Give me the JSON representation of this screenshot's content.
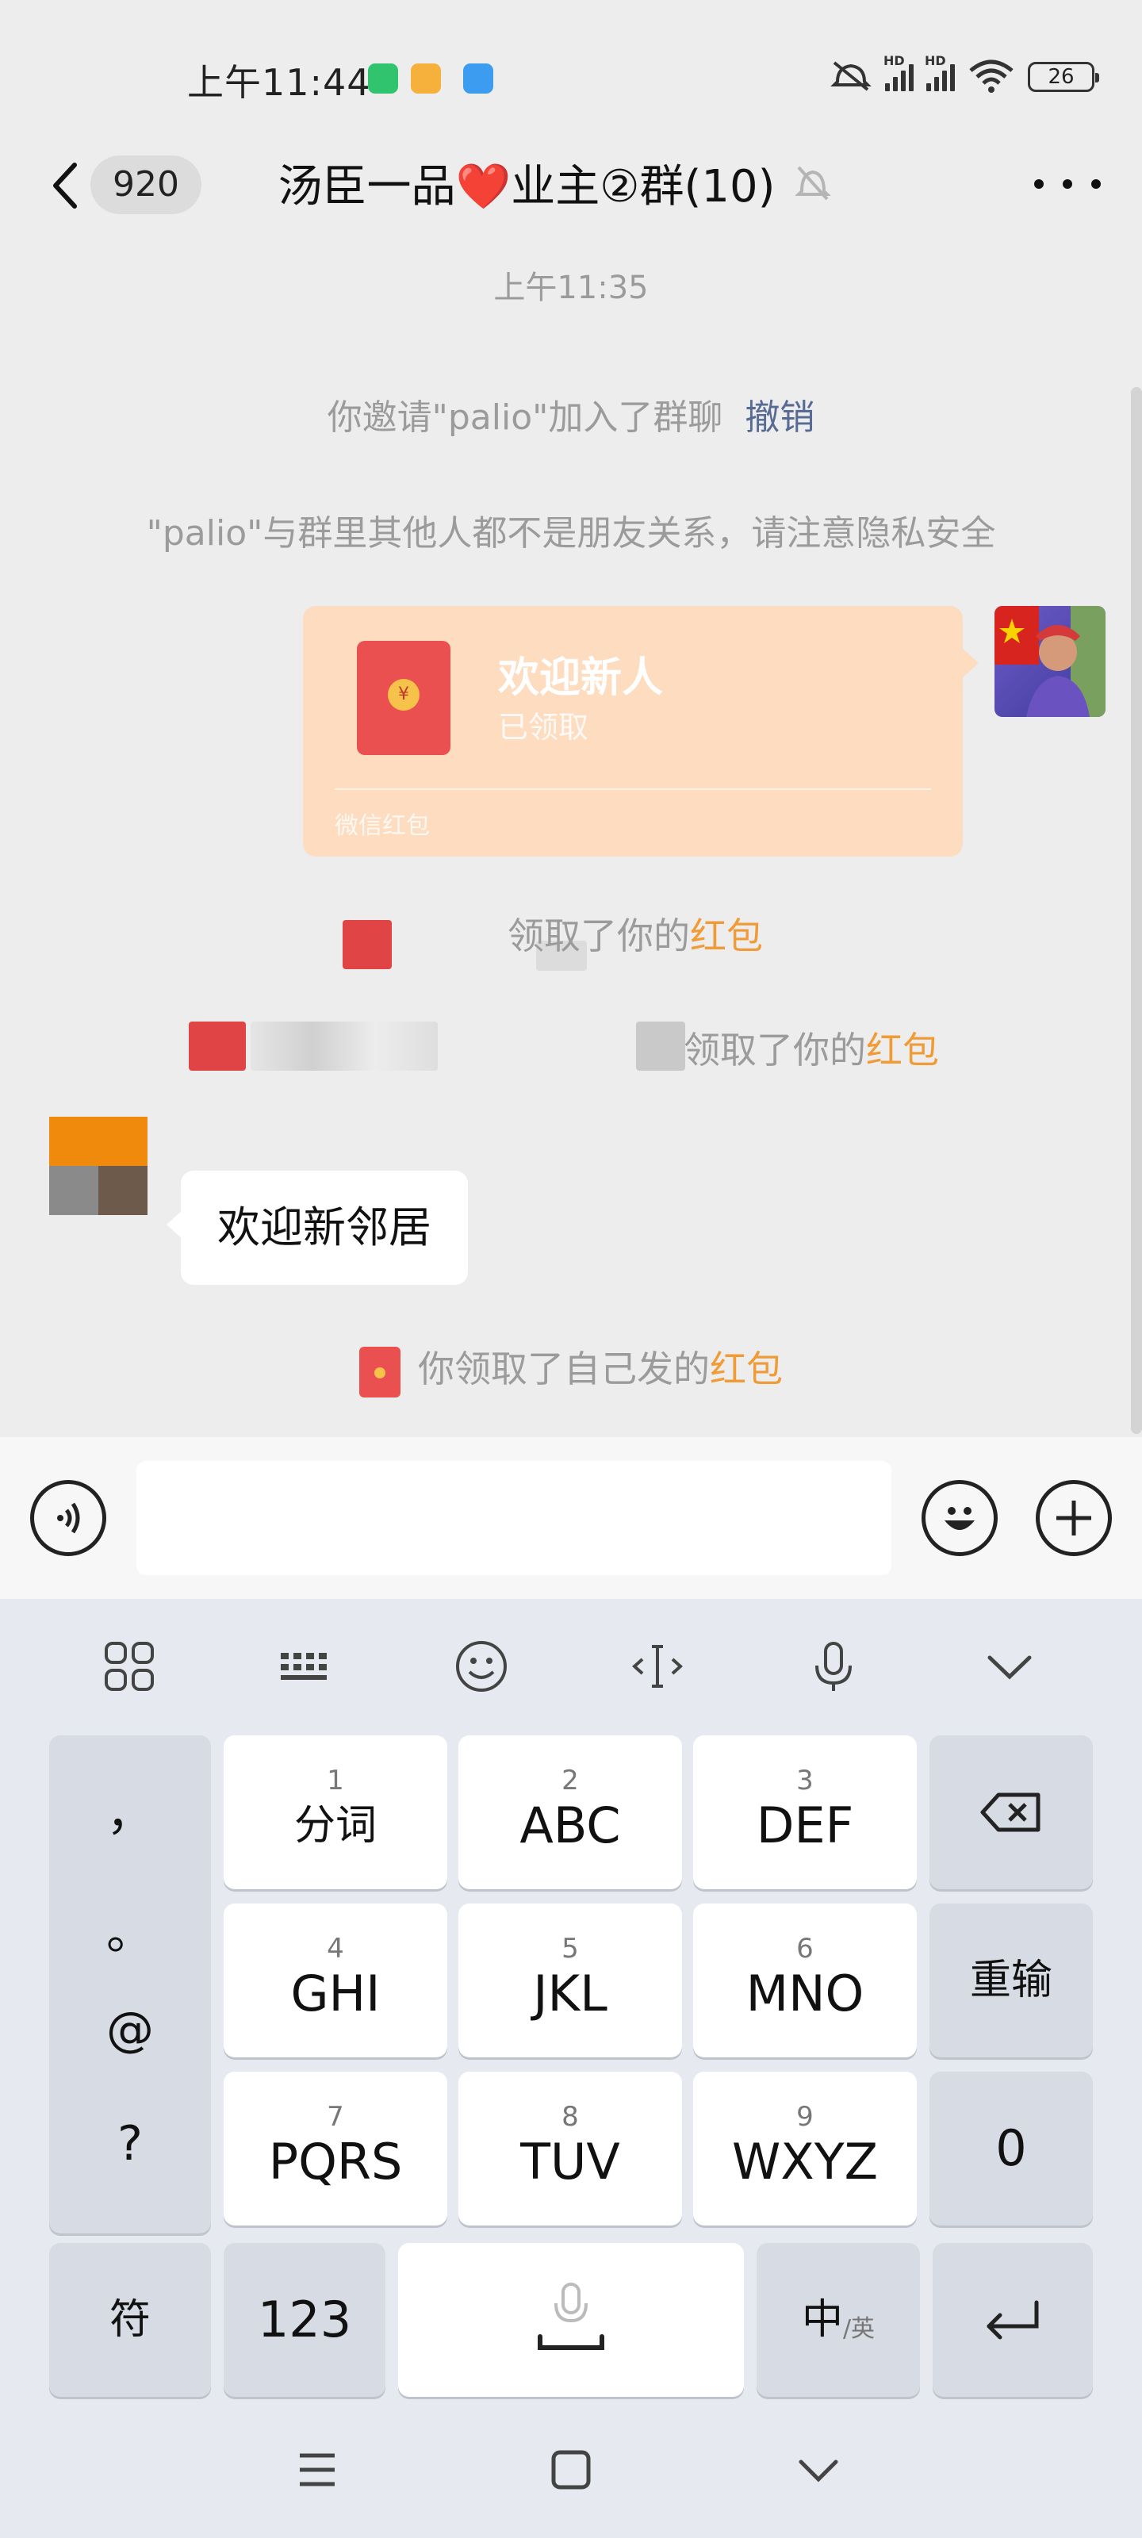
{
  "status_bar": {
    "time": "上午11:44",
    "network_labels": [
      "HD",
      "HD"
    ],
    "battery": "26",
    "notif_icons": [
      "wechat-notif-icon",
      "files-notif-icon",
      "app-notif-icon"
    ]
  },
  "header": {
    "unread_count": "920",
    "title": "汤臣一品❤️业主②群(10)",
    "icons": [
      "back-icon",
      "mute-bell-icon",
      "more-icon"
    ]
  },
  "messages": {
    "timestamp": "上午11:35",
    "invite_text": "你邀请\"palio\"加入了群聊",
    "invite_revoke": "撤销",
    "privacy_notice": "\"palio\"与群里其他人都不是朋友关系，请注意隐私安全",
    "red_packet": {
      "title": "欢迎新人",
      "status": "已领取",
      "footer": "微信红包"
    },
    "claim_1": {
      "text": "领取了你的",
      "link": "红包"
    },
    "claim_2": {
      "text": "领取了你的",
      "link": "红包"
    },
    "chat_bubble": "欢迎新邻居",
    "self_claim": {
      "text": "你领取了自己发的",
      "link": "红包"
    }
  },
  "input_bar": {
    "placeholder": "",
    "icons": [
      "voice-icon",
      "emoji-icon",
      "plus-icon"
    ]
  },
  "keyboard": {
    "toolbar_icons": [
      "grid-icon",
      "keyboard-icon",
      "emoji-icon",
      "cursor-icon",
      "microphone-icon",
      "collapse-icon"
    ],
    "punctuation": [
      "，",
      "。",
      "@",
      "?"
    ],
    "rows": [
      [
        {
          "num": "1",
          "label": "分词"
        },
        {
          "num": "2",
          "label": "ABC"
        },
        {
          "num": "3",
          "label": "DEF"
        }
      ],
      [
        {
          "num": "4",
          "label": "GHI"
        },
        {
          "num": "5",
          "label": "JKL"
        },
        {
          "num": "6",
          "label": "MNO"
        }
      ],
      [
        {
          "num": "7",
          "label": "PQRS"
        },
        {
          "num": "8",
          "label": "TUV"
        },
        {
          "num": "9",
          "label": "WXYZ"
        }
      ]
    ],
    "reinput": "重输",
    "zero": "0",
    "symbol": "符",
    "num_mode": "123",
    "lang_main": "中",
    "lang_sub": "/英"
  },
  "colors": {
    "accent_orange": "#f09b36",
    "link_blue": "#576b95",
    "red_packet_bg": "#fddcbf"
  }
}
